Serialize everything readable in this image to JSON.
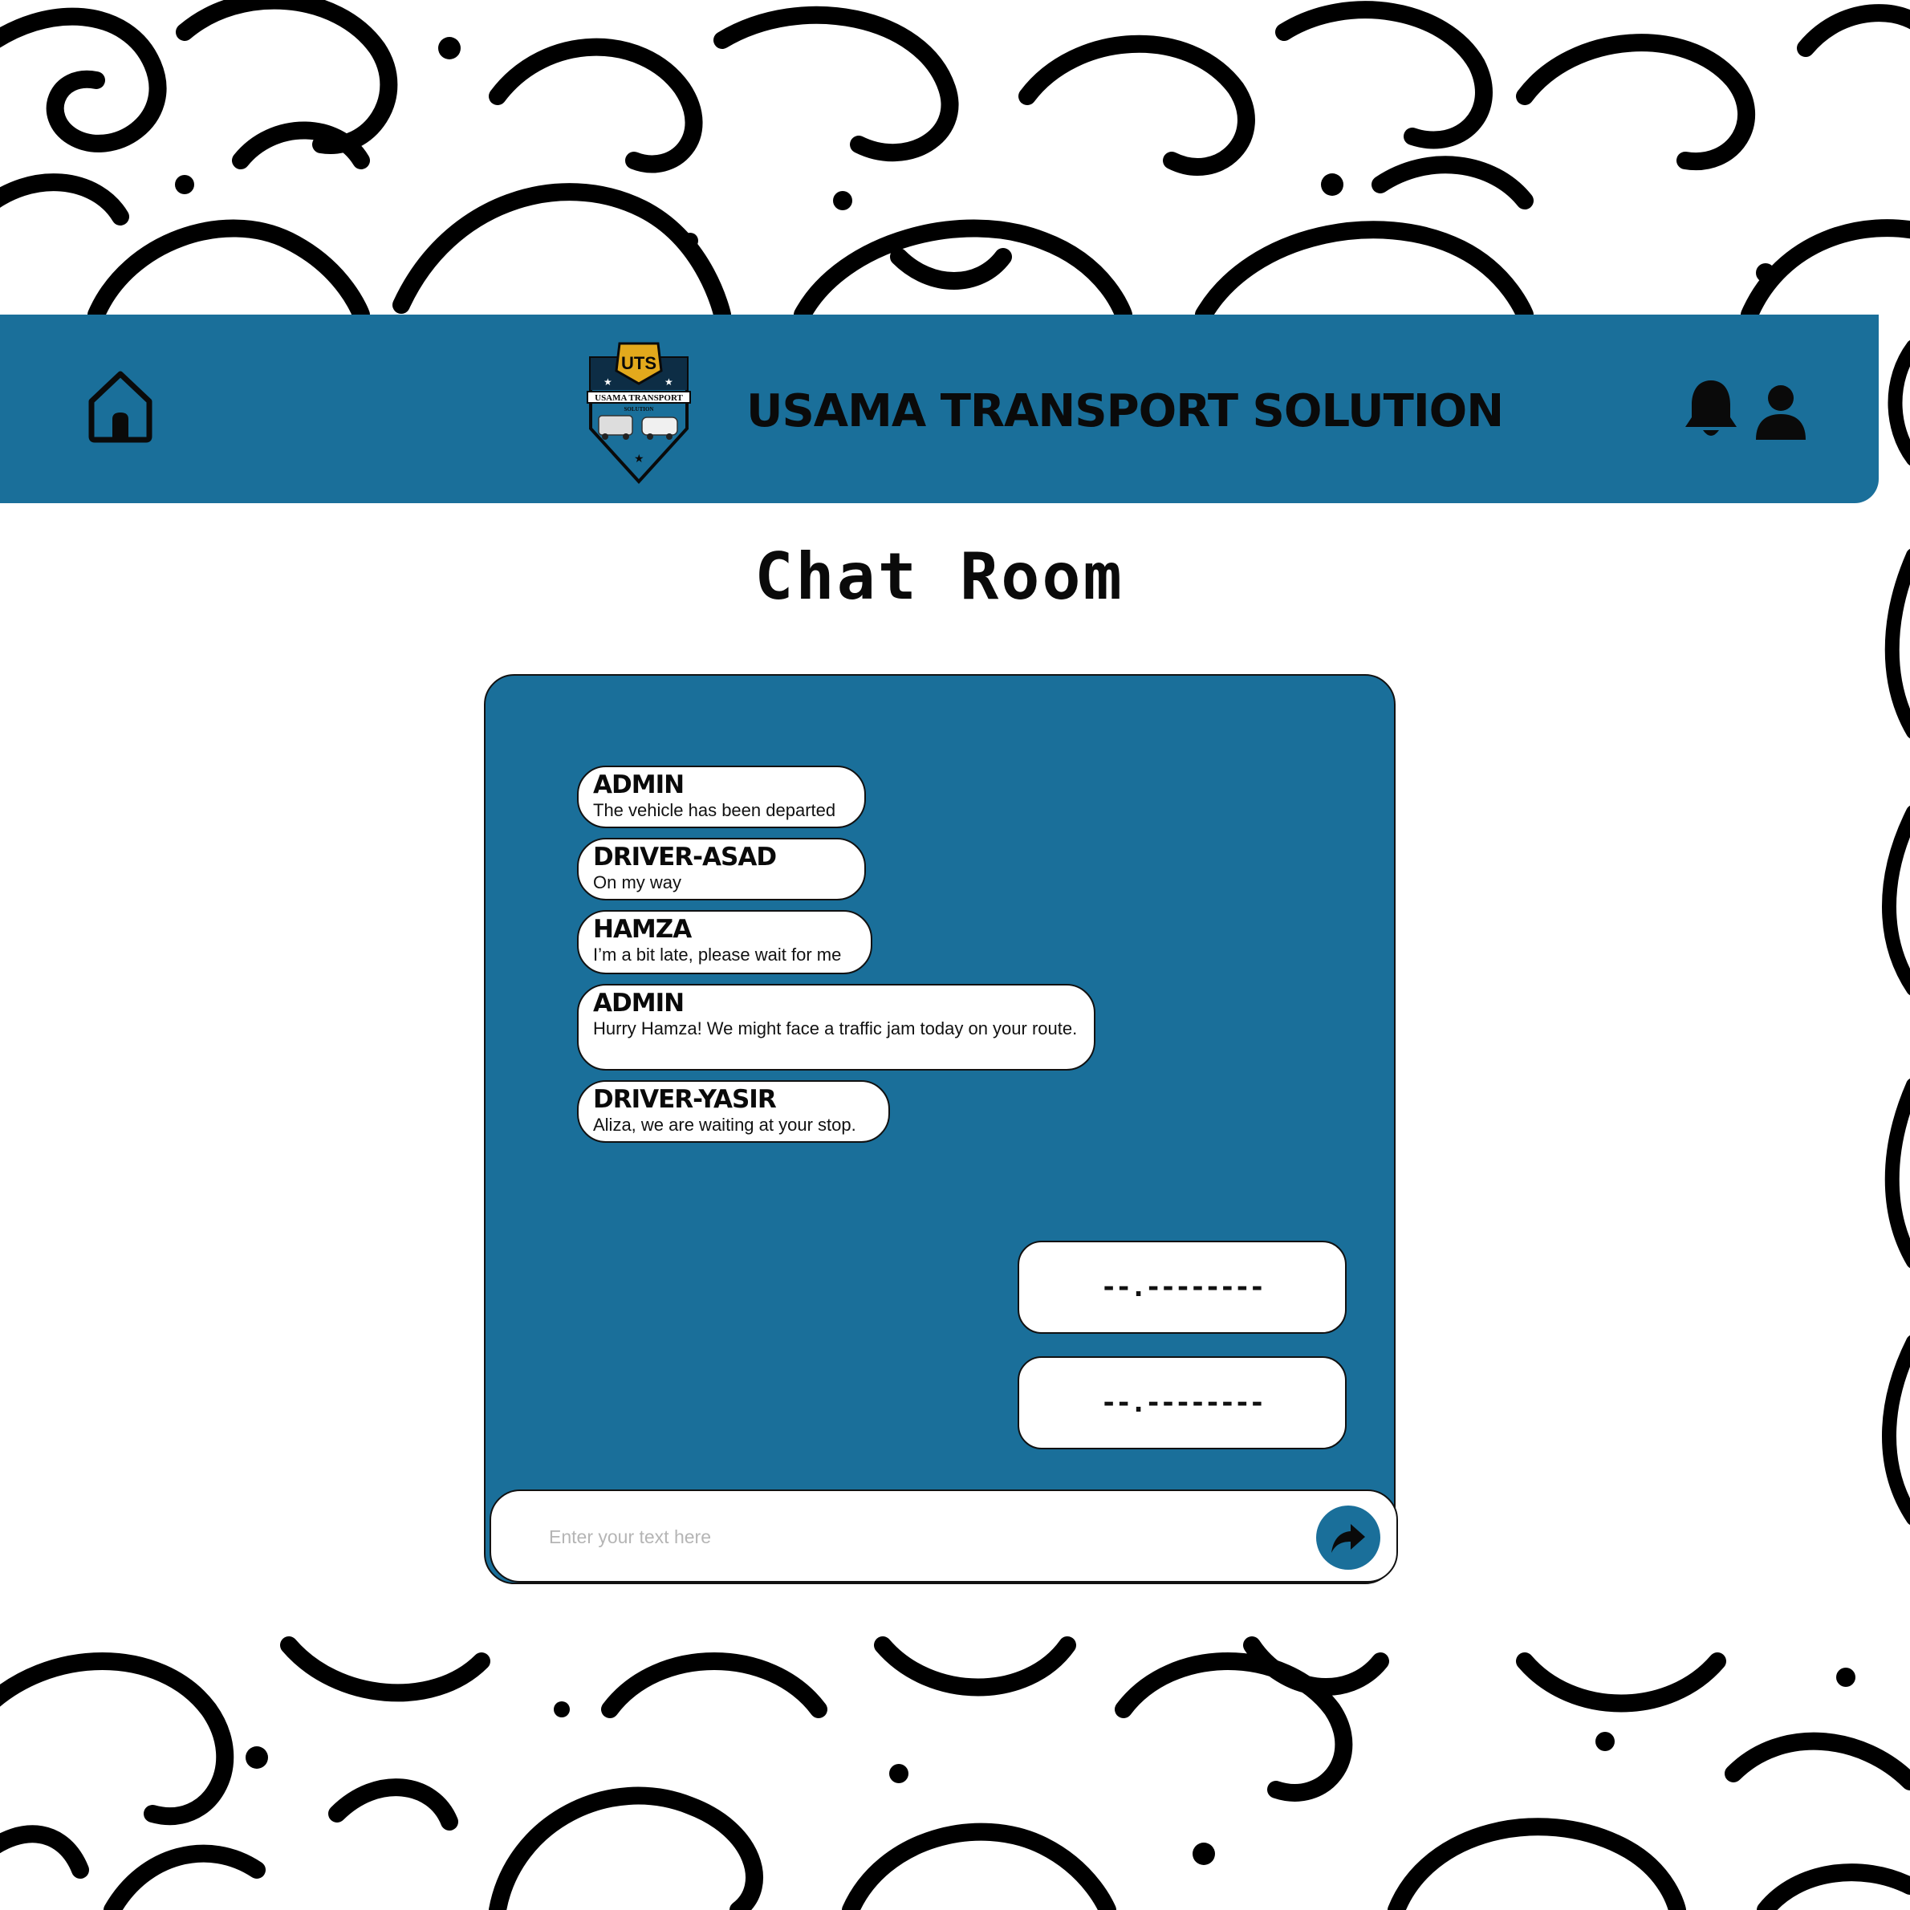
{
  "app": {
    "brand_name": "USAMA TRANSPORT SOLUTION",
    "logo": {
      "monogram": "UTS",
      "text_line1": "USAMA TRANSPORT",
      "text_line2": "SOLUTION"
    }
  },
  "header": {
    "left_icon": "home-icon",
    "right_icons": [
      "bell-icon",
      "user-icon"
    ]
  },
  "page": {
    "title": "Chat Room"
  },
  "chat": {
    "messages": [
      {
        "sender": "ADMIN",
        "text": "The vehicle has been departed"
      },
      {
        "sender": "DRIVER-ASAD",
        "text": "On my way"
      },
      {
        "sender": "HAMZA",
        "text": "I’m a bit late, please wait for me"
      },
      {
        "sender": "ADMIN",
        "text": "Hurry Hamza! We might face a traffic jam today on your route."
      },
      {
        "sender": "DRIVER-YASIR",
        "text": "Aliza, we are waiting at your stop."
      }
    ],
    "outgoing_placeholders": [
      "--.--------",
      "--.--------"
    ],
    "input": {
      "placeholder": "Enter your text here",
      "value": ""
    },
    "send_icon": "share-arrow-icon"
  },
  "colors": {
    "primary": "#1a6f9a",
    "text": "#0a0a0a",
    "background": "#ffffff"
  }
}
